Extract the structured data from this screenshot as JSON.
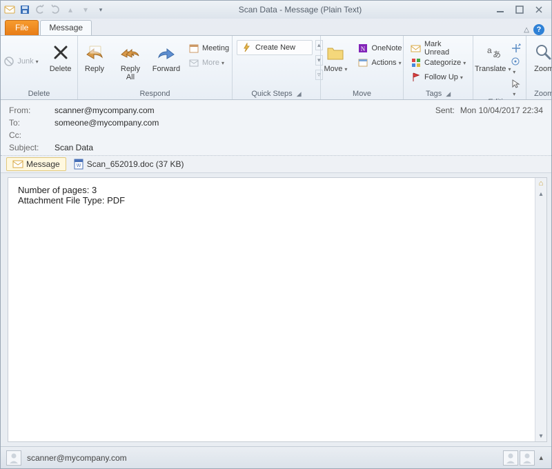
{
  "window": {
    "title": "Scan Data  -  Message (Plain Text)"
  },
  "qat": {
    "save": "save-icon",
    "undo": "undo-icon",
    "redo": "redo-icon",
    "prev": "prev-icon",
    "next": "next-icon"
  },
  "tabs": {
    "file": "File",
    "message": "Message"
  },
  "ribbon": {
    "delete": {
      "junk": "Junk",
      "delete": "Delete",
      "group": "Delete"
    },
    "respond": {
      "reply": "Reply",
      "replyall": "Reply\nAll",
      "forward": "Forward",
      "meeting": "Meeting",
      "more": "More",
      "group": "Respond"
    },
    "quicksteps": {
      "create": "Create New",
      "group": "Quick Steps"
    },
    "move": {
      "move": "Move",
      "onenote": "OneNote",
      "actions": "Actions",
      "group": "Move"
    },
    "tags": {
      "unread": "Mark Unread",
      "categorize": "Categorize",
      "followup": "Follow Up",
      "group": "Tags"
    },
    "editing": {
      "translate": "Translate",
      "group": "Editing"
    },
    "zoom": {
      "zoom": "Zoom",
      "group": "Zoom"
    }
  },
  "headers": {
    "from_label": "From:",
    "from": "scanner@mycompany.com",
    "to_label": "To:",
    "to": "someone@mycompany.com",
    "cc_label": "Cc:",
    "cc": "",
    "subject_label": "Subject:",
    "subject": "Scan Data",
    "sent_label": "Sent:",
    "sent": "Mon 10/04/2017 22:34"
  },
  "attachments": {
    "message_tab": "Message",
    "file_name": "Scan_652019.doc (37 KB)"
  },
  "body": {
    "line1": "Number of pages: 3",
    "line2": "Attachment File Type: PDF"
  },
  "status": {
    "sender": "scanner@mycompany.com"
  }
}
